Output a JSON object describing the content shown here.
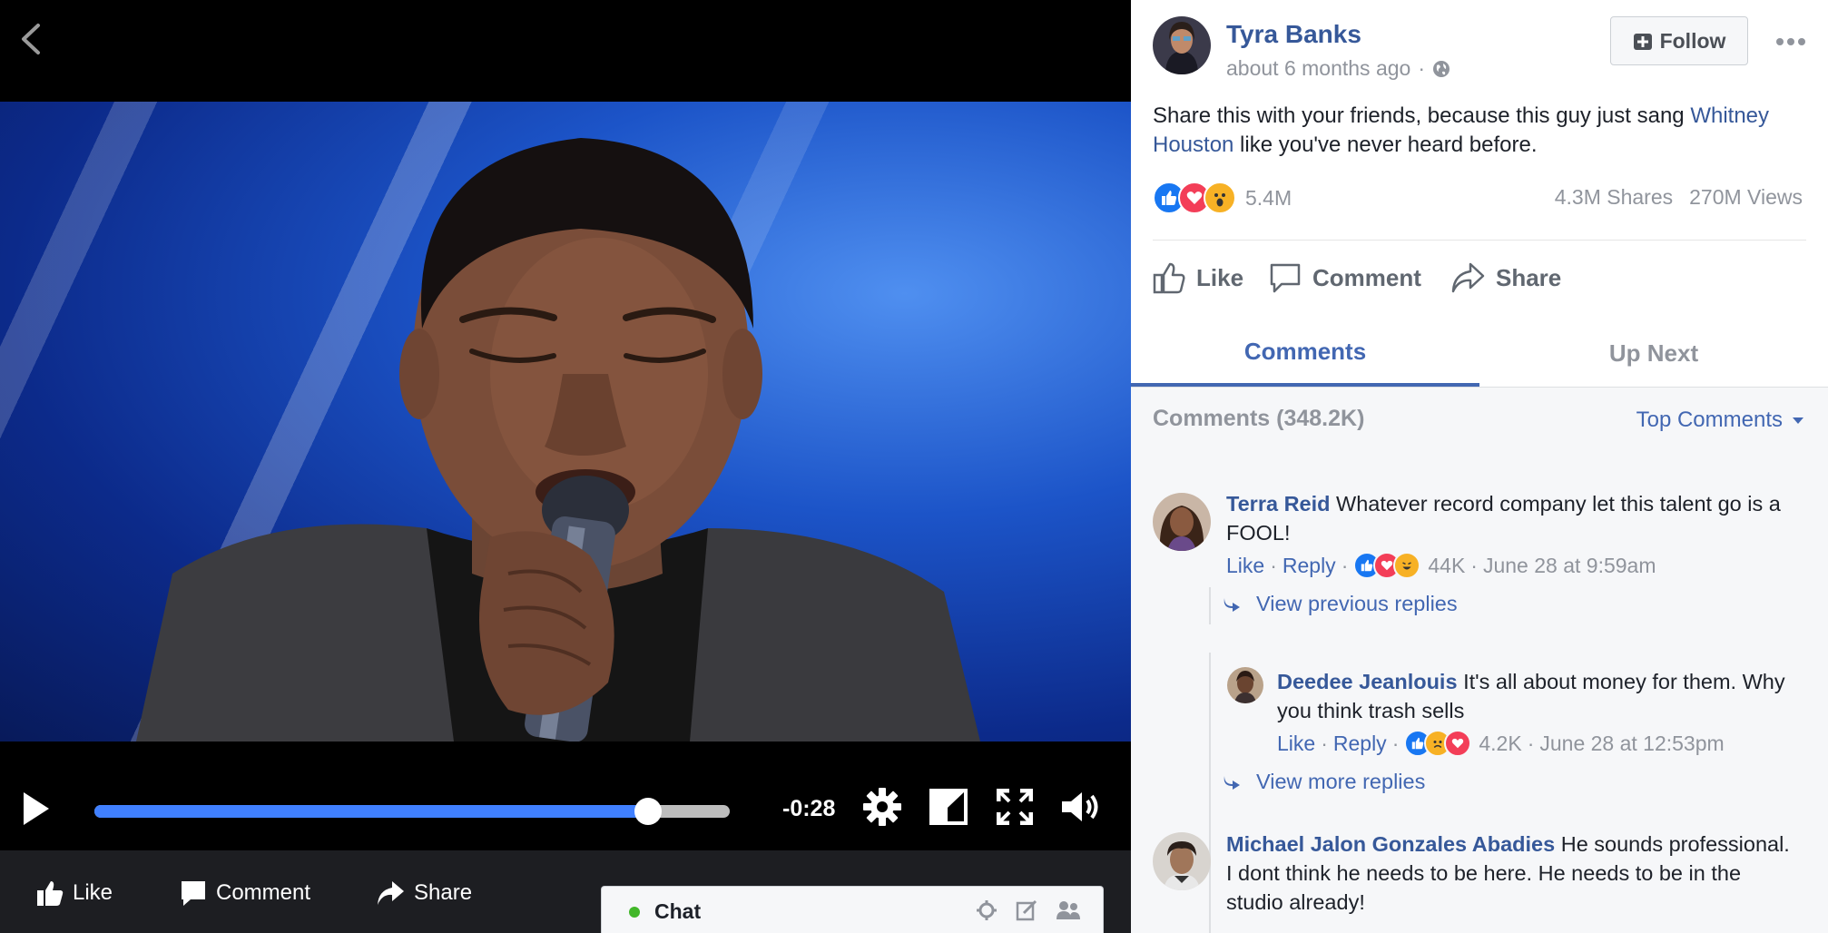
{
  "video": {
    "time_remaining": "-0:28",
    "progress_fraction": 0.872
  },
  "actions": {
    "like": "Like",
    "comment": "Comment",
    "share": "Share"
  },
  "chat": {
    "label": "Chat"
  },
  "post": {
    "author": "Tyra Banks",
    "timestamp": "about 6 months ago",
    "meta_sep": "·",
    "follow_label": "Follow",
    "text_before": "Share this with your friends, because this guy just sang ",
    "text_link": "Whitney Houston",
    "text_after": " like you've never heard before.",
    "reaction_count": "5.4M",
    "shares": "4.3M Shares",
    "views": "270M Views"
  },
  "tabs": {
    "comments": "Comments",
    "up_next": "Up Next"
  },
  "comments_header": {
    "count": "Comments (348.2K)",
    "sort": "Top Comments"
  },
  "comments": [
    {
      "name": "Terra Reid",
      "text": "Whatever record company let this talent go is a FOOL!",
      "like": "Like",
      "reply": "Reply",
      "reactions": "44K",
      "time": "June 28 at 9:59am"
    },
    {
      "name": "Deedee Jeanlouis",
      "text": "It's all about money for them. Why you think trash sells",
      "like": "Like",
      "reply": "Reply",
      "reactions": "4.2K",
      "time": "June 28 at 12:53pm"
    },
    {
      "name": "Michael Jalon Gonzales Abadies",
      "text": "He sounds professional. I dont think he needs to be here. He needs to be in the studio already!"
    }
  ],
  "replies": {
    "view_previous": "View previous replies",
    "view_more": "View more replies"
  },
  "colors": {
    "link": "#365899",
    "accent": "#4267b2",
    "progress": "#4080ff",
    "like_blue": "#1877f2",
    "love_red": "#f33e58",
    "wow_yellow": "#f7b125"
  }
}
